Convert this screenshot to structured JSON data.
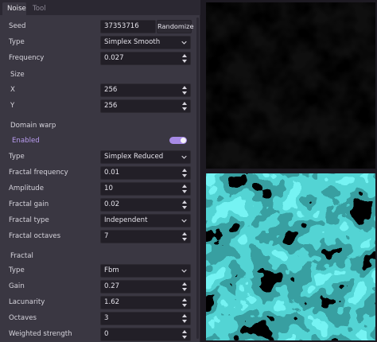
{
  "tabs": [
    {
      "label": "Noise",
      "active": true
    },
    {
      "label": "Tool",
      "active": false
    }
  ],
  "noise": {
    "seed": {
      "label": "Seed",
      "value": "37353716",
      "button": "Randomize"
    },
    "type": {
      "label": "Type",
      "value": "Simplex Smooth"
    },
    "frequency": {
      "label": "Frequency",
      "value": "0.027"
    },
    "size": {
      "label": "Size",
      "x_label": "X",
      "x_value": "256",
      "y_label": "Y",
      "y_value": "256"
    }
  },
  "domain_warp": {
    "label": "Domain warp",
    "enabled_label": "Enabled",
    "enabled": true,
    "type": {
      "label": "Type",
      "value": "Simplex Reduced"
    },
    "fractal_frequency": {
      "label": "Fractal frequency",
      "value": "0.01"
    },
    "amplitude": {
      "label": "Amplitude",
      "value": "10"
    },
    "fractal_gain": {
      "label": "Fractal gain",
      "value": "0.02"
    },
    "fractal_type": {
      "label": "Fractal type",
      "value": "Independent"
    },
    "fractal_octaves": {
      "label": "Fractal octaves",
      "value": "7"
    }
  },
  "fractal": {
    "label": "Fractal",
    "type": {
      "label": "Type",
      "value": "Fbm"
    },
    "gain": {
      "label": "Gain",
      "value": "0.27"
    },
    "lacunarity": {
      "label": "Lacunarity",
      "value": "1.62"
    },
    "octaves": {
      "label": "Octaves",
      "value": "3"
    },
    "weighted_strength": {
      "label": "Weighted strength",
      "value": "0"
    }
  },
  "colors": {
    "panel": "#3a3742",
    "field": "#221f27",
    "accent": "#b99cf0",
    "toggle": "#a78ae6",
    "teal_bright": "#2fe6e6",
    "teal_mid": "#16a8a8",
    "teal_dark": "#0b5a5c"
  },
  "icons": {
    "spinner": "spinner-updown-icon",
    "dropdown": "chevron-down-icon"
  }
}
